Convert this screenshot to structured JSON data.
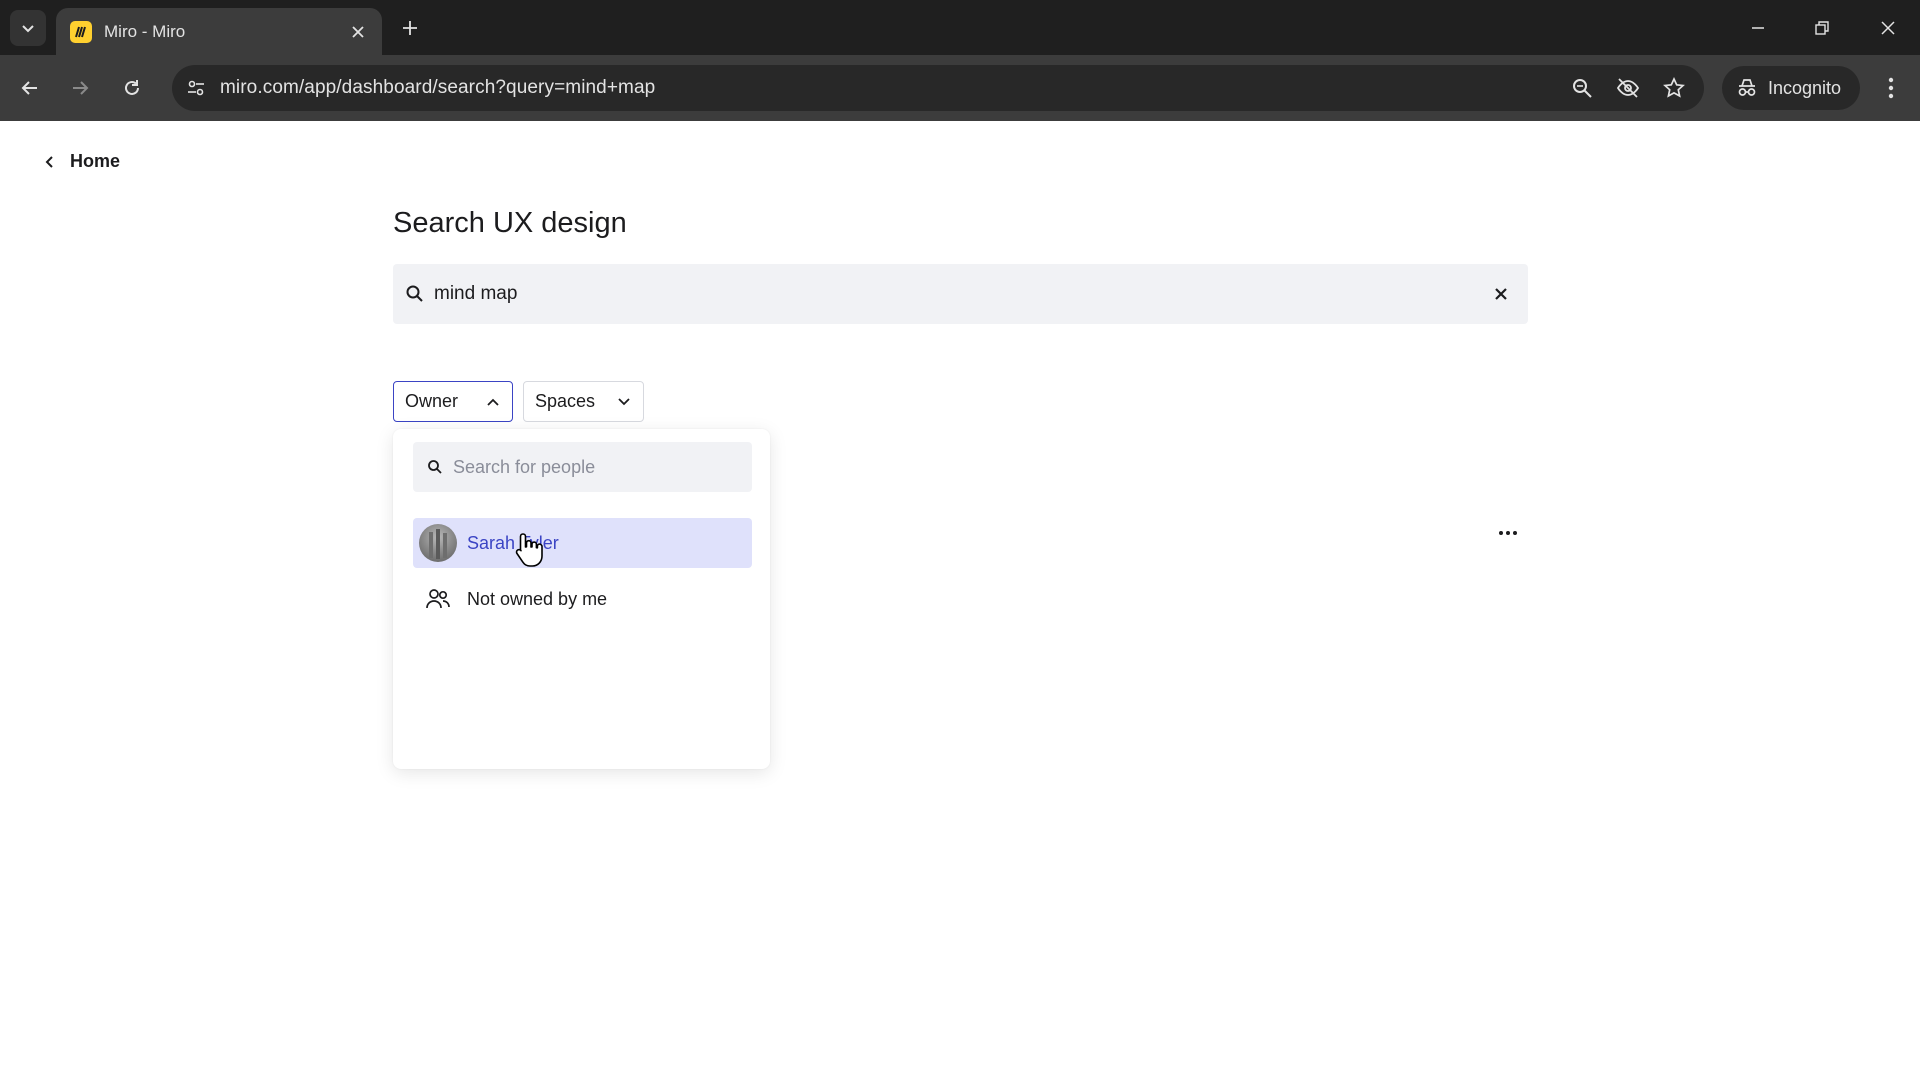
{
  "browser": {
    "tab_title": "Miro - Miro",
    "url": "miro.com/app/dashboard/search?query=mind+map",
    "incognito_label": "Incognito"
  },
  "page": {
    "back_label": "Home",
    "title": "Search UX design",
    "search": {
      "value": "mind map"
    },
    "filters": [
      {
        "label": "Owner",
        "state": "expanded"
      },
      {
        "label": "Spaces",
        "state": "collapsed"
      }
    ],
    "owner_dropdown": {
      "search_placeholder": "Search for people",
      "items": [
        {
          "label": "Sarah Tyler",
          "selected": true,
          "icon": "avatar"
        },
        {
          "label": "Not owned by me",
          "selected": false,
          "icon": "people-icon"
        }
      ]
    }
  },
  "colors": {
    "accent": "#3b44c4",
    "selected_bg": "#dfe1fb",
    "favicon": "#ffd02f"
  }
}
